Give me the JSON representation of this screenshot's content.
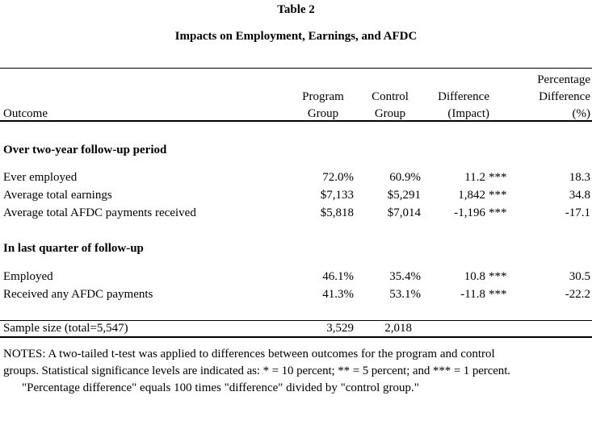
{
  "table": {
    "number": "Table 2",
    "title": "Impacts on Employment, Earnings, and AFDC",
    "headers": {
      "outcome": "Outcome",
      "program": [
        "Program",
        "Group"
      ],
      "control": [
        "Control",
        "Group"
      ],
      "difference": [
        "Difference",
        "(Impact)"
      ],
      "pct": [
        "Percentage",
        "Difference",
        "(%)"
      ]
    },
    "sections": [
      {
        "label": "Over two-year follow-up period",
        "rows": [
          {
            "outcome": "Ever employed",
            "program": "72.0%",
            "control": "60.9%",
            "difference": "11.2",
            "sig": "***",
            "pct": "18.3"
          },
          {
            "outcome": "Average total earnings",
            "program": "$7,133",
            "control": "$5,291",
            "difference": "1,842",
            "sig": "***",
            "pct": "34.8"
          },
          {
            "outcome": "Average total AFDC payments received",
            "program": "$5,818",
            "control": "$7,014",
            "difference": "-1,196",
            "sig": "***",
            "pct": "-17.1"
          }
        ]
      },
      {
        "label": "In last quarter of follow-up",
        "rows": [
          {
            "outcome": "Employed",
            "program": "46.1%",
            "control": "35.4%",
            "difference": "10.8",
            "sig": "***",
            "pct": "30.5"
          },
          {
            "outcome": "Received any AFDC payments",
            "program": "41.3%",
            "control": "53.1%",
            "difference": "-11.8",
            "sig": "***",
            "pct": "-22.2"
          }
        ]
      }
    ],
    "sample": {
      "label": "Sample size (total=5,547)",
      "program": "3,529",
      "control": "2,018"
    },
    "notes": [
      "NOTES:  A two-tailed t-test was applied to differences between outcomes for the program and control",
      "groups.  Statistical significance levels are indicated as:  * = 10 percent; ** = 5 percent; and *** = 1 percent.",
      "\"Percentage difference\" equals 100 times \"difference\" divided by \"control group.\""
    ]
  }
}
